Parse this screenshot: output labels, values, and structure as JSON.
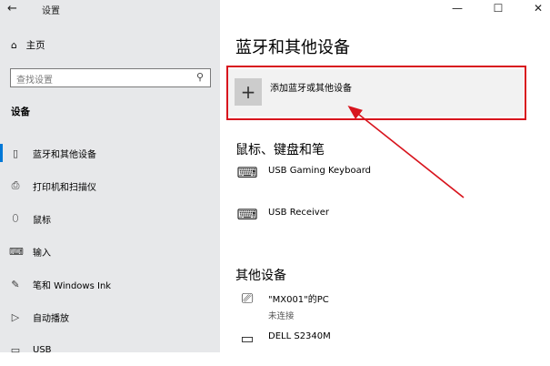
{
  "sidebar": {
    "back_glyph": "←",
    "app_title": "设置",
    "home_label": "主页",
    "search_placeholder": "查找设置",
    "section_title": "设备",
    "items": [
      {
        "label": "蓝牙和其他设备",
        "icon": "bluetooth-devices-icon",
        "active": true
      },
      {
        "label": "打印机和扫描仪",
        "icon": "printer-icon",
        "active": false
      },
      {
        "label": "鼠标",
        "icon": "mouse-icon",
        "active": false
      },
      {
        "label": "输入",
        "icon": "keyboard-icon",
        "active": false
      },
      {
        "label": "笔和 Windows Ink",
        "icon": "pen-icon",
        "active": false
      },
      {
        "label": "自动播放",
        "icon": "autoplay-icon",
        "active": false
      },
      {
        "label": "USB",
        "icon": "usb-icon",
        "active": false
      }
    ]
  },
  "main": {
    "page_title": "蓝牙和其他设备",
    "add_device_label": "添加蓝牙或其他设备",
    "mouse_keyboard_section": "鼠标、键盘和笔",
    "mouse_keyboard_devices": [
      {
        "name": "USB Gaming Keyboard"
      },
      {
        "name": "USB Receiver"
      }
    ],
    "other_section": "其他设备",
    "other_devices": [
      {
        "name": "\"MX001\"的PC",
        "status": "未连接"
      },
      {
        "name": "DELL S2340M",
        "status": ""
      }
    ]
  },
  "colors": {
    "sidebar_bg": "#e7e8ea",
    "accent": "#0078d7",
    "highlight_red": "#d8141d"
  }
}
